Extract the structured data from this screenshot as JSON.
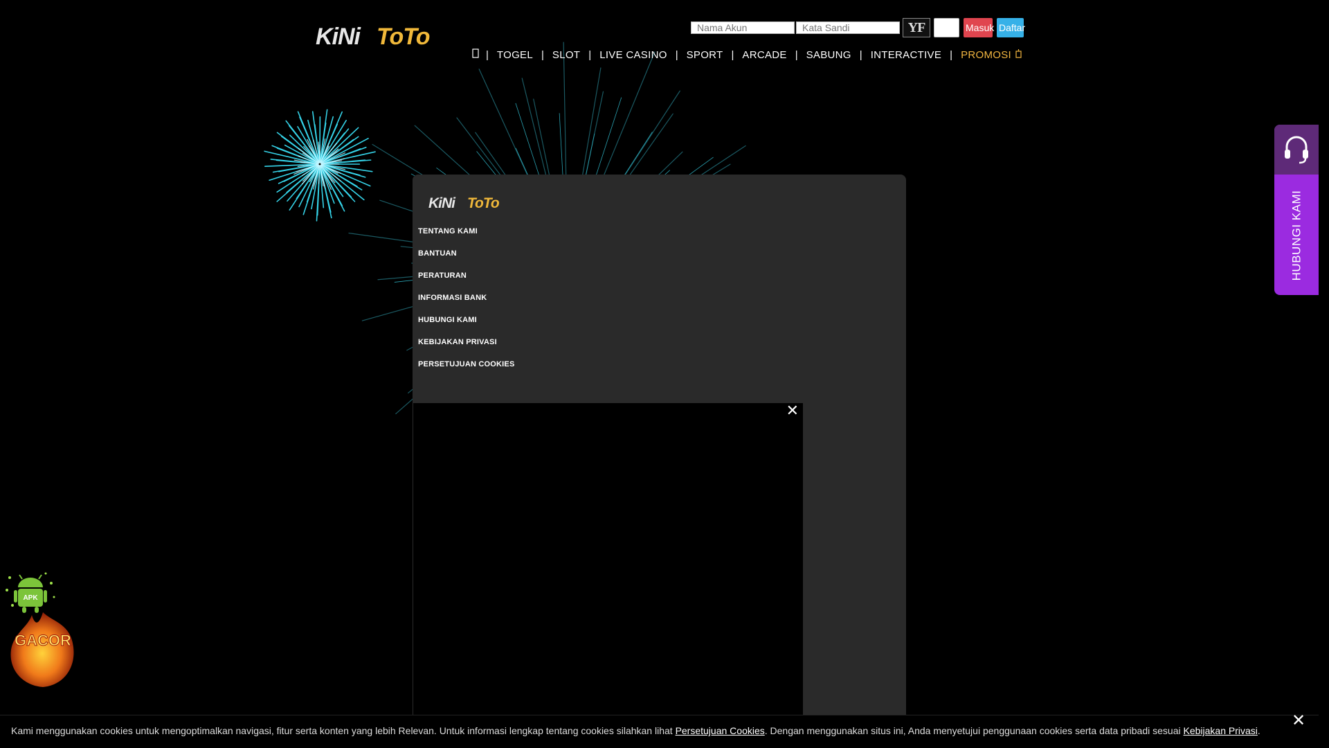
{
  "header": {
    "logo_text": "KiNiToTo",
    "username_placeholder": "Nama Akun",
    "password_placeholder": "Kata Sandi",
    "captcha_text": "YF",
    "login_label": "Masuk",
    "register_label": "Daftar"
  },
  "nav": {
    "home_icon": "home-icon",
    "items": [
      "TOGEL",
      "SLOT",
      "LIVE CASINO",
      "SPORT",
      "ARCADE",
      "SABUNG",
      "INTERACTIVE"
    ],
    "promo_label": "PROMOSI",
    "promo_icon": "gift-icon"
  },
  "panel": {
    "logo_text": "KiNiToTo",
    "links": [
      "TENTANG KAMI",
      "BANTUAN",
      "PERATURAN",
      "INFORMASI BANK",
      "HUBUNGI KAMI",
      "KEBIJAKAN PRIVASI",
      "PERSETUJUAN COOKIES"
    ]
  },
  "popup": {
    "close_icon": "close-icon"
  },
  "contact": {
    "label": "HUBUNGI KAMI",
    "icon": "headset-icon",
    "color": "#9b2be0"
  },
  "floating": {
    "apk_text": "APK",
    "gacor_text": "GACOR"
  },
  "cookie": {
    "text_1": "Kami menggunakan cookies untuk mengoptimalkan navigasi, fitur serta konten yang lebih Relevan. Untuk informasi lengkap tentang cookies silahkan lihat ",
    "link_1": "Persetujuan Cookies",
    "text_2": ". Dengan menggunakan situs ini, Anda menyetujui penggunaan cookies serta data pribadi sesuai ",
    "link_2": "Kebijakan Privasi",
    "text_3": ".",
    "close_icon": "close-icon"
  },
  "colors": {
    "login": "#e0454f",
    "register": "#36b1e8",
    "promo": "#f2b640",
    "panel": "#2a2a2a"
  }
}
